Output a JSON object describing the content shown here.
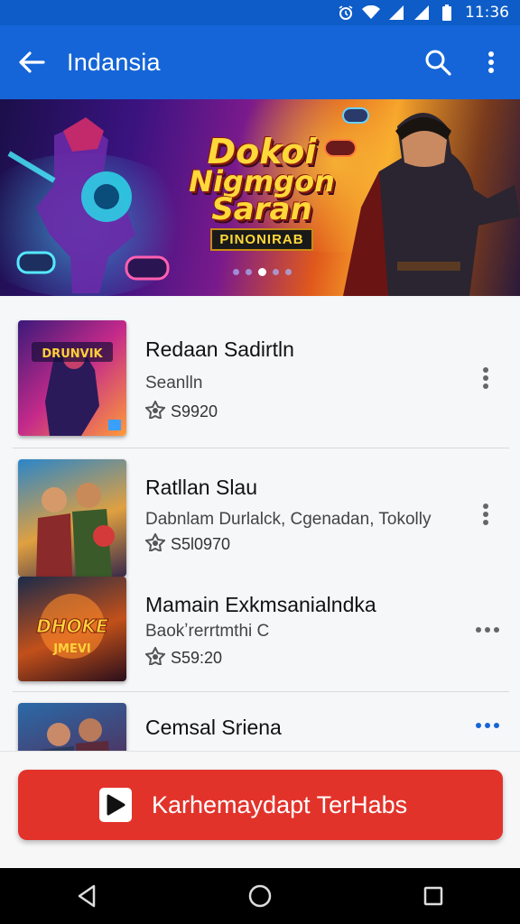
{
  "status_bar": {
    "time": "11:36",
    "icons": [
      "alarm-icon",
      "wifi-icon",
      "signal-icon",
      "signal-icon",
      "battery-icon"
    ]
  },
  "app_bar": {
    "title": "Indansia",
    "back_icon": "arrow-back-icon",
    "search_icon": "search-icon",
    "more_icon": "more-vert-icon"
  },
  "banner": {
    "title_lines": [
      "Dokoi",
      "Nigmgon",
      "Saran"
    ],
    "subtitle": "PINONIRAB",
    "page_indicator": {
      "count": 5,
      "active": 2
    }
  },
  "list": {
    "items": [
      {
        "name": "Redaan Sadirtln",
        "meta": "Seanlln",
        "price": "S9920",
        "menu_icon": "more-vert-icon"
      },
      {
        "name": "Ratllan Slau",
        "meta": "Dabnlam Durlalck, Cgenadan, Tokolly",
        "price": "S5l0970",
        "menu_icon": "more-vert-icon"
      },
      {
        "name": "Mamain Exkmsanialndka",
        "meta": "Baokʼrerrtmthi C",
        "price": "S59:20",
        "menu_icon": "more-horiz-icon"
      },
      {
        "name": "Cemsal Sriena",
        "meta": "",
        "price": "",
        "menu_icon": "more-horiz-icon"
      }
    ]
  },
  "cta": {
    "label": "Karhemaydapt TerHabs",
    "icon": "play-store-icon"
  },
  "nav_bar": {
    "icons": [
      "back-triangle-icon",
      "home-circle-icon",
      "recents-square-icon"
    ]
  },
  "colors": {
    "app_bar": "#1565d8",
    "status_bar": "#0d5cc7",
    "cta": "#e2332b",
    "menu_accent": "#1565d8"
  }
}
